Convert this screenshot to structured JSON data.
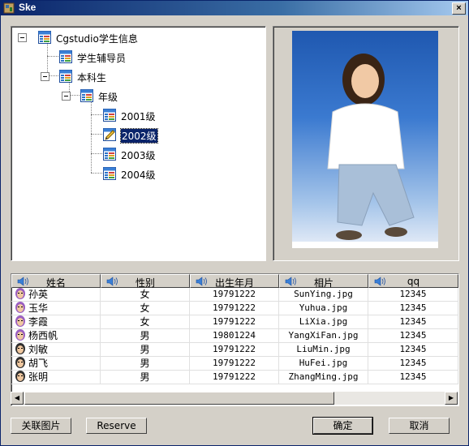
{
  "window": {
    "title": "Ske",
    "close_glyph": "×"
  },
  "tree": {
    "nodes": [
      {
        "label": "Cgstudio学生信息",
        "icon": "table-icon"
      },
      {
        "label": "学生辅导员",
        "icon": "table-icon"
      },
      {
        "label": "本科生",
        "icon": "table-icon"
      },
      {
        "label": "年级",
        "icon": "table-icon"
      },
      {
        "label": "2001级",
        "icon": "table-icon"
      },
      {
        "label": "2002级",
        "icon": "pencil-icon",
        "selected": true
      },
      {
        "label": "2003级",
        "icon": "table-icon"
      },
      {
        "label": "2004级",
        "icon": "table-icon"
      }
    ]
  },
  "grid": {
    "columns": [
      "姓名",
      "性别",
      "出生年月",
      "相片",
      "qq"
    ],
    "rows": [
      {
        "avatar": "female-avatar-icon",
        "name": "孙英",
        "gender": "女",
        "birth": "19791222",
        "photo": "SunYing.jpg",
        "qq": "12345"
      },
      {
        "avatar": "female-avatar-icon",
        "name": "玉华",
        "gender": "女",
        "birth": "19791222",
        "photo": "Yuhua.jpg",
        "qq": "12345"
      },
      {
        "avatar": "female-avatar-icon",
        "name": "李霞",
        "gender": "女",
        "birth": "19791222",
        "photo": "LiXia.jpg",
        "qq": "12345"
      },
      {
        "avatar": "female-avatar-icon",
        "name": "杨西帆",
        "gender": "男",
        "birth": "19801224",
        "photo": "YangXiFan.jpg",
        "qq": "12345"
      },
      {
        "avatar": "male-avatar-icon",
        "name": "刘敏",
        "gender": "男",
        "birth": "19791222",
        "photo": "LiuMin.jpg",
        "qq": "12345"
      },
      {
        "avatar": "male-avatar-icon",
        "name": "胡飞",
        "gender": "男",
        "birth": "19791222",
        "photo": "HuFei.jpg",
        "qq": "12345"
      },
      {
        "avatar": "male-avatar-icon",
        "name": "张明",
        "gender": "男",
        "birth": "19791222",
        "photo": "ZhangMing.jpg",
        "qq": "12345"
      }
    ]
  },
  "buttons": {
    "link_image": "关联图片",
    "reserve": "Reserve",
    "ok": "确定",
    "cancel": "取消"
  },
  "colors": {
    "titlebar": "#0a246a",
    "selection": "#0a246a",
    "face": "#d4d0c8"
  }
}
